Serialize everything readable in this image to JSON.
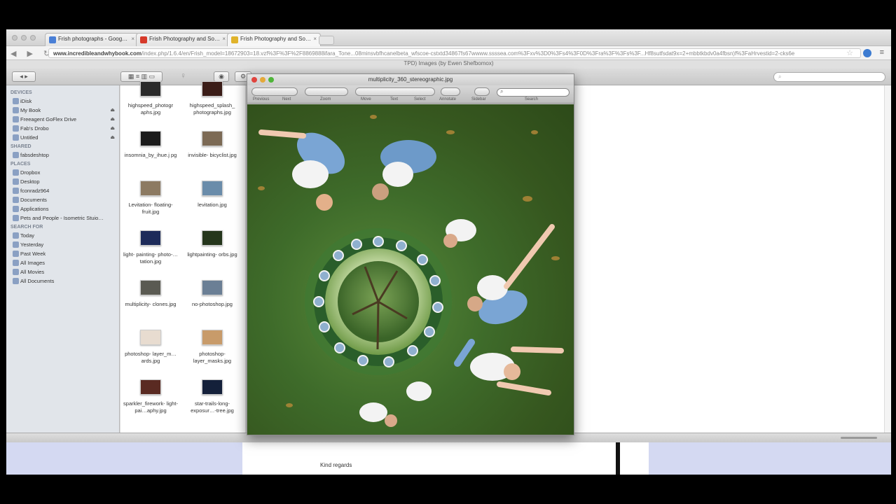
{
  "browser": {
    "tabs": [
      {
        "label": "Frish photographs - Goog…",
        "favicon_color": "#4a7fd6",
        "active": false
      },
      {
        "label": "Frish Photography and So…",
        "favicon_color": "#d63a2a",
        "active": false
      },
      {
        "label": "Frish Photography and So…",
        "favicon_color": "#e0b32b",
        "active": true
      }
    ],
    "url_host": "www.incredibleandwhybook.com",
    "url_rest": "/index.php/1.6.4/en/Frish_model=18672903=18.vzf%3F%3F%2F8869888ifara_Tone...08minsvbfhcanelbeta_wfscoe-cstxtd34867fs67wwww.ssssea.com%3Fxv%3D0%3Fs4%3F0D%3Fra%3F%3Fs%3F...Hf8sutfsdat9x=2+mbbtkbdv0a4fbsn)f%3FaHrvestid=2-cks6e"
  },
  "finder": {
    "window_title": "TPD) Images (by Ewen Shefbomox)",
    "search_placeholder": "",
    "sidebar": [
      {
        "heading": "DEVICES",
        "items": [
          {
            "label": "iDisk",
            "eject": false
          },
          {
            "label": "My Book",
            "eject": true
          },
          {
            "label": "Freeagent GoFlex Drive",
            "eject": true
          },
          {
            "label": "Fab's Drobo",
            "eject": true
          },
          {
            "label": "Untitled",
            "eject": true
          }
        ]
      },
      {
        "heading": "SHARED",
        "items": [
          {
            "label": "fabsdeshtop",
            "eject": false
          }
        ]
      },
      {
        "heading": "PLACES",
        "items": [
          {
            "label": "Dropbox",
            "eject": false
          },
          {
            "label": "Desktop",
            "eject": false
          },
          {
            "label": "fconradz964",
            "eject": false
          },
          {
            "label": "Documents",
            "eject": false
          },
          {
            "label": "Applications",
            "eject": false
          },
          {
            "label": "Pets and People - Isometric Stuio…",
            "eject": false
          }
        ]
      },
      {
        "heading": "SEARCH FOR",
        "items": [
          {
            "label": "Today",
            "eject": false
          },
          {
            "label": "Yesterday",
            "eject": false
          },
          {
            "label": "Past Week",
            "eject": false
          },
          {
            "label": "All Images",
            "eject": false
          },
          {
            "label": "All Movies",
            "eject": false
          },
          {
            "label": "All Documents",
            "eject": false
          }
        ]
      }
    ],
    "files": [
      {
        "name": "highspeed_photogr aphs.jpg",
        "thumb": "#2a2a2a"
      },
      {
        "name": "highspeed_splash_ photographs.jpg",
        "thumb": "#3b1d18"
      },
      {
        "name": "insomnia_by_ihue.j pg",
        "thumb": "#1b1b1b"
      },
      {
        "name": "invisible- bicyclist.jpg",
        "thumb": "#7c6a55"
      },
      {
        "name": "Levitation- floating-fruit.jpg",
        "thumb": "#8c7a62"
      },
      {
        "name": "levitation.jpg",
        "thumb": "#6a8caa"
      },
      {
        "name": "light- painting- photo-…tation.jpg",
        "thumb": "#1d2b5a"
      },
      {
        "name": "lightpainting- orbs.jpg",
        "thumb": "#25361c"
      },
      {
        "name": "multiplicity- clones.jpg",
        "thumb": "#5a5a52"
      },
      {
        "name": "no-photoshop.jpg",
        "thumb": "#6b7f95"
      },
      {
        "name": "photoshop- layer_m…ards.jpg",
        "thumb": "#e8dcd0"
      },
      {
        "name": "photoshop- layer_masks.jpg",
        "thumb": "#c89b6a"
      },
      {
        "name": "sparkler_firework- light-pai…aphy.jpg",
        "thumb": "#5a2a22"
      },
      {
        "name": "star-trails-long- exposur…-tree.jpg",
        "thumb": "#14203a"
      }
    ]
  },
  "preview": {
    "title": "multiplicity_360_stereographic.jpg",
    "toolbar_labels": [
      "Previous",
      "Next",
      "Zoom",
      "Move",
      "Text",
      "Select",
      "Annotate",
      "Sidebar",
      "Search"
    ]
  },
  "page": {
    "lines": [
      "Kind regards"
    ]
  }
}
